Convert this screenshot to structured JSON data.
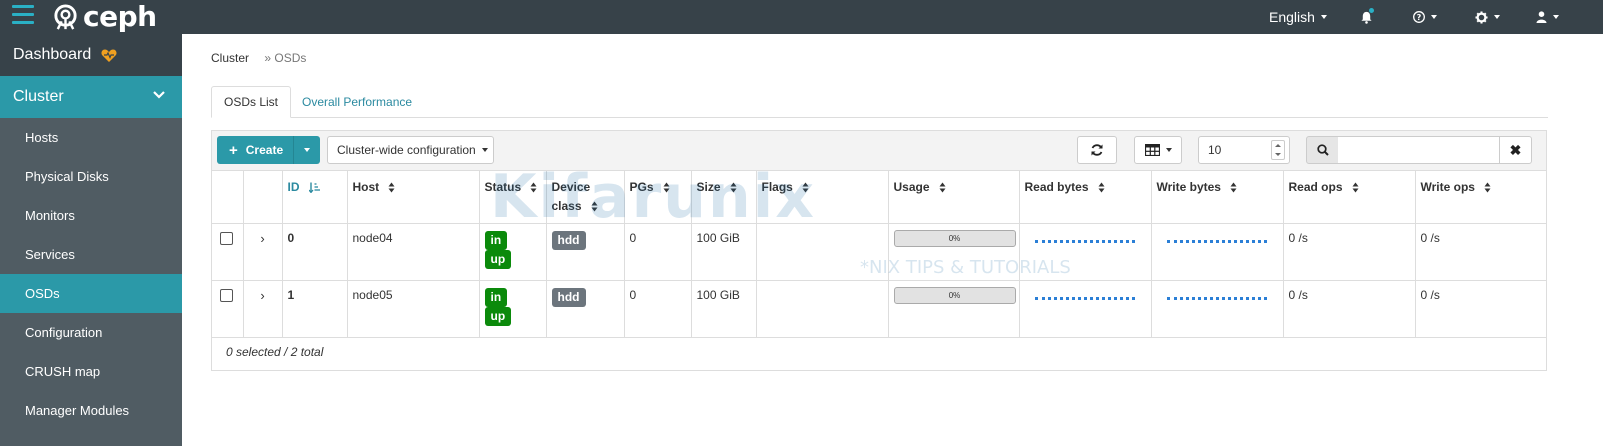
{
  "topbar": {
    "brand": "ceph",
    "language": "English",
    "icons": [
      "menu-icon",
      "ceph-logo-icon",
      "bell-icon",
      "help-icon",
      "gear-icon",
      "user-icon"
    ],
    "accent_color": "#2ab0c5"
  },
  "sidebar": {
    "dashboard_label": "Dashboard",
    "cluster_label": "Cluster",
    "items": [
      {
        "label": "Hosts"
      },
      {
        "label": "Physical Disks"
      },
      {
        "label": "Monitors"
      },
      {
        "label": "Services"
      },
      {
        "label": "OSDs"
      },
      {
        "label": "Configuration"
      },
      {
        "label": "CRUSH map"
      },
      {
        "label": "Manager Modules"
      }
    ],
    "active_item": "OSDs",
    "active_color": "#2b99a8"
  },
  "breadcrumb": {
    "parent": "Cluster",
    "separator": "»",
    "current": "OSDs"
  },
  "tabs": [
    {
      "label": "OSDs List",
      "active": true
    },
    {
      "label": "Overall Performance",
      "active": false
    }
  ],
  "toolbar": {
    "create_label": "Create",
    "config_label": "Cluster-wide configuration",
    "page_size": "10",
    "search_placeholder": "",
    "clear_label": "✖"
  },
  "table": {
    "columns": [
      "ID",
      "Host",
      "Status",
      "Device class",
      "PGs",
      "Size",
      "Flags",
      "Usage",
      "Read bytes",
      "Write bytes",
      "Read ops",
      "Write ops"
    ],
    "rows": [
      {
        "id": "0",
        "host": "node04",
        "status": [
          "in",
          "up"
        ],
        "device_class": "hdd",
        "pgs": "0",
        "size": "100 GiB",
        "flags": "",
        "usage": "0%",
        "read_ops": "0 /s",
        "write_ops": "0 /s"
      },
      {
        "id": "1",
        "host": "node05",
        "status": [
          "in",
          "up"
        ],
        "device_class": "hdd",
        "pgs": "0",
        "size": "100 GiB",
        "flags": "",
        "usage": "0%",
        "read_ops": "0 /s",
        "write_ops": "0 /s"
      }
    ],
    "footer": "0 selected / 2 total"
  },
  "watermark": {
    "main": "Kifarunix",
    "tagline": "*NIX TIPS & TUTORIALS"
  }
}
